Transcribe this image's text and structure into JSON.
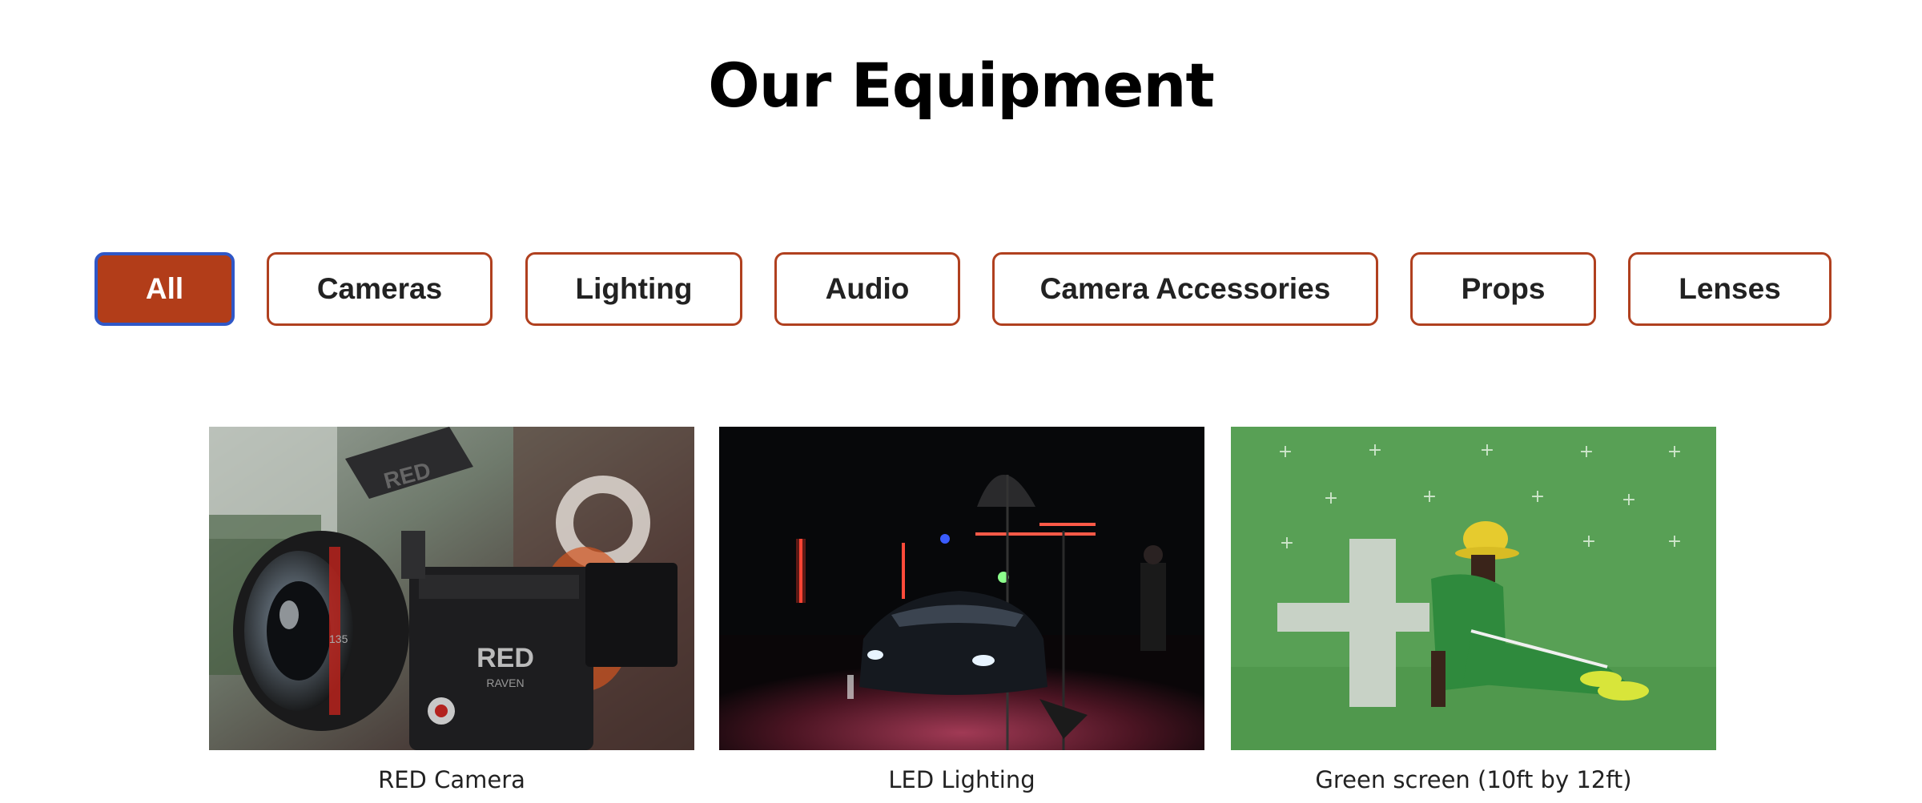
{
  "page": {
    "title": "Our Equipment"
  },
  "filters": [
    {
      "label": "All",
      "active": true
    },
    {
      "label": "Cameras",
      "active": false
    },
    {
      "label": "Lighting",
      "active": false
    },
    {
      "label": "Audio",
      "active": false
    },
    {
      "label": "Camera Accessories",
      "active": false
    },
    {
      "label": "Props",
      "active": false
    },
    {
      "label": "Lenses",
      "active": false
    }
  ],
  "items": [
    {
      "caption": "RED Camera",
      "image": "red-camera-photo",
      "camera_brand": "RED",
      "camera_model": "RAVEN",
      "lens_mark": "135"
    },
    {
      "caption": "LED Lighting",
      "image": "led-lighting-photo"
    },
    {
      "caption": "Green screen (10ft by 12ft)",
      "image": "green-screen-photo"
    }
  ],
  "colors": {
    "accent": "#b23d19",
    "accent_border": "#b0401f",
    "focus_ring": "#2f57c7",
    "text": "#222222"
  }
}
